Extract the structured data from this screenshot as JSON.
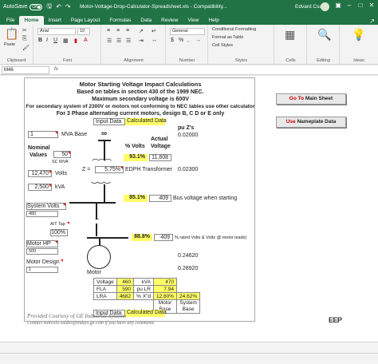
{
  "titlebar": {
    "autosave_label": "AutoSave",
    "autosave_state": "Off",
    "document_title": "Motor-Voltage-Drop-Calculator-Spreadsheet.xls - Compatibility...",
    "user_name": "Edvard Csanji"
  },
  "ribbon_tabs": [
    "File",
    "Home",
    "Insert",
    "Page Layout",
    "Formulas",
    "Data",
    "Review",
    "View",
    "Help"
  ],
  "ribbon": {
    "paste_label": "Paste",
    "clipboard_label": "Clipboard",
    "font_name": "Arial",
    "font_size": "10",
    "font_label": "Font",
    "alignment_label": "Alignment",
    "number_format": "General",
    "number_label": "Number",
    "conditional_formatting": "Conditional Formatting",
    "format_as_table": "Format as Table",
    "cell_styles": "Cell Styles",
    "styles_label": "Styles",
    "cells_label": "Cells",
    "editing_label": "Editing",
    "ideas_label": "Ideas"
  },
  "formula_bar": {
    "name_box": "M46",
    "fx": "fx",
    "content": ""
  },
  "sheet": {
    "title_lines": [
      "Motor Starting Voltage Impact Calculations",
      "Based on tables in section 430 of the 1999 NEC.",
      "Maximum secondary voltage is 600V",
      "For secondary system of 2300V or motors not conforming to NEC tables use other calculator",
      "For 3 Phase alternating current motors, design B, C D or E only"
    ],
    "legend_input": "Input Data",
    "legend_calculated": "Calculated Data",
    "buttons": {
      "goto_accent": "Go To",
      "goto_rest": " Main Sheet",
      "use_accent": "Use",
      "use_rest": " Nameplate Data"
    },
    "mva_value": "1",
    "mva_label": "MVA Base",
    "nominal_label": "Nominal",
    "values_label": "Values",
    "sc_mva_value": "50",
    "sc_mva_label": "SC MVA",
    "volts_value": "12,470",
    "volts_label": "Volts",
    "kva_value": "2,500",
    "kva_label": "kVA",
    "system_volts_label": "System Volts",
    "system_volts_value": "480",
    "at_tap_label": "A/T Tap",
    "at_tap_value": "100%",
    "motor_hp_label": "Motor HP",
    "motor_hp_value": "500",
    "motor_design_label": "Motor  Design",
    "motor_design_value": "1",
    "infinite_symbol": "∞",
    "pu_z_header": "pu Z's",
    "pu_z_1": "0.02000",
    "pct_volts_header": "% Volts",
    "actual_voltage_header_1": "Actual",
    "actual_voltage_header_2": "Voltage",
    "pct_volts_1": "93.1%",
    "actual_voltage_1": "11,608",
    "z_label": "Z =",
    "z_value": "5.75%",
    "transformer_label": "EDPH Transformer",
    "pu_z_2": "0.02300",
    "pct_volts_2": "85.1%",
    "actual_voltage_2": "409",
    "bus_voltage_label": "Bus voltage when starting",
    "pct_volts_3": "88.8%",
    "actual_voltage_3": "409",
    "rated_volts_label": "% rated Volts & Volts @ motor leads)",
    "pu_z_3": "0.24620",
    "pu_z_4": "0.28920",
    "motor_label": "Motor",
    "motor_table": [
      [
        "Voltage",
        "460",
        "kVA",
        "470"
      ],
      [
        "FLA",
        "590",
        "pu LR",
        "7.94"
      ],
      [
        "LRA",
        "4682",
        "% X\"d",
        "12.60%",
        "24.62%"
      ],
      [
        "",
        "",
        "",
        "Motor Base",
        "System Base"
      ]
    ],
    "footer_line1": "Provided Courtesy of GE Industrial Systems",
    "footer_line2": "Contact marcelo.valdes@indsys.ge.com if you have any comments",
    "logo_text": "EEP"
  },
  "colors": {
    "excel_green": "#217346",
    "calc_yellow": "#ffff66",
    "accent_red": "#cc0000"
  }
}
